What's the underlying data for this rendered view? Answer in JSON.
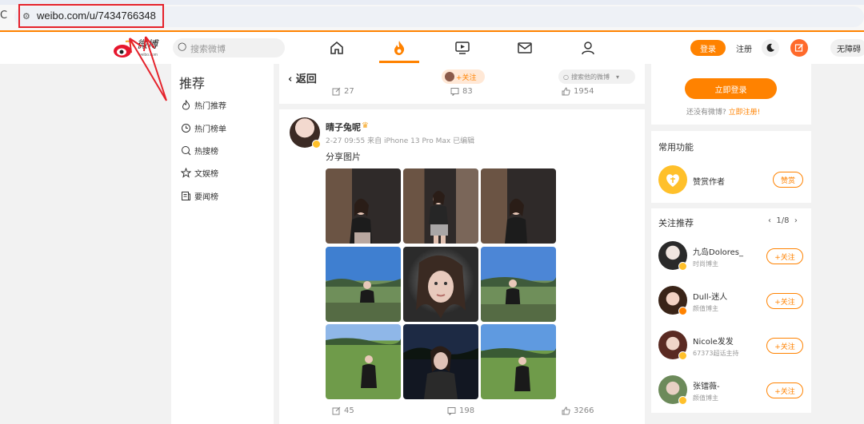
{
  "browser": {
    "reload_glyph": "C",
    "url": "weibo.com/u/7434766348"
  },
  "header": {
    "search_placeholder": "搜索微博",
    "login_label": "登录",
    "register_label": "注册",
    "accessibility_label": "无障碍",
    "brand_color": "#ff8200"
  },
  "left_sidebar": {
    "title": "推荐",
    "items": [
      {
        "label": "热门推荐",
        "icon": "flame-icon"
      },
      {
        "label": "热门榜单",
        "icon": "clock-icon"
      },
      {
        "label": "热搜榜",
        "icon": "search-rank-icon"
      },
      {
        "label": "文娱榜",
        "icon": "star-icon"
      },
      {
        "label": "要闻榜",
        "icon": "news-icon"
      }
    ]
  },
  "top_card": {
    "back_label": "返回",
    "follow_chip": "+关注",
    "search_his_placeholder": "搜索他的微博",
    "stats": {
      "reposts": "27",
      "comments": "83",
      "likes": "1954"
    }
  },
  "post": {
    "username": "晴子兔呢",
    "meta": "2-27 09:55 来自 iPhone 13 Pro Max 已编辑",
    "text": "分享图片",
    "stats": {
      "reposts": "45",
      "comments": "198",
      "likes": "3266"
    }
  },
  "right_panel": {
    "login_button": "立即登录",
    "no_account_prefix": "还没有微博?",
    "register_link": "立即注册!",
    "common_functions_title": "常用功能",
    "reward_label": "赞赏作者",
    "reward_button": "赞赏",
    "recommend_title": "关注推荐",
    "pager": "1/8",
    "recommendations": [
      {
        "name": "九岛Dolores_",
        "desc": "时尚博主",
        "follow": "+关注"
      },
      {
        "name": "Dull-迷人",
        "desc": "颜值博主",
        "follow": "+关注"
      },
      {
        "name": "Nicole发发",
        "desc": "67373超话主持",
        "follow": "+关注"
      },
      {
        "name": "张镭薇-",
        "desc": "颜值博主",
        "follow": "+关注"
      }
    ]
  }
}
